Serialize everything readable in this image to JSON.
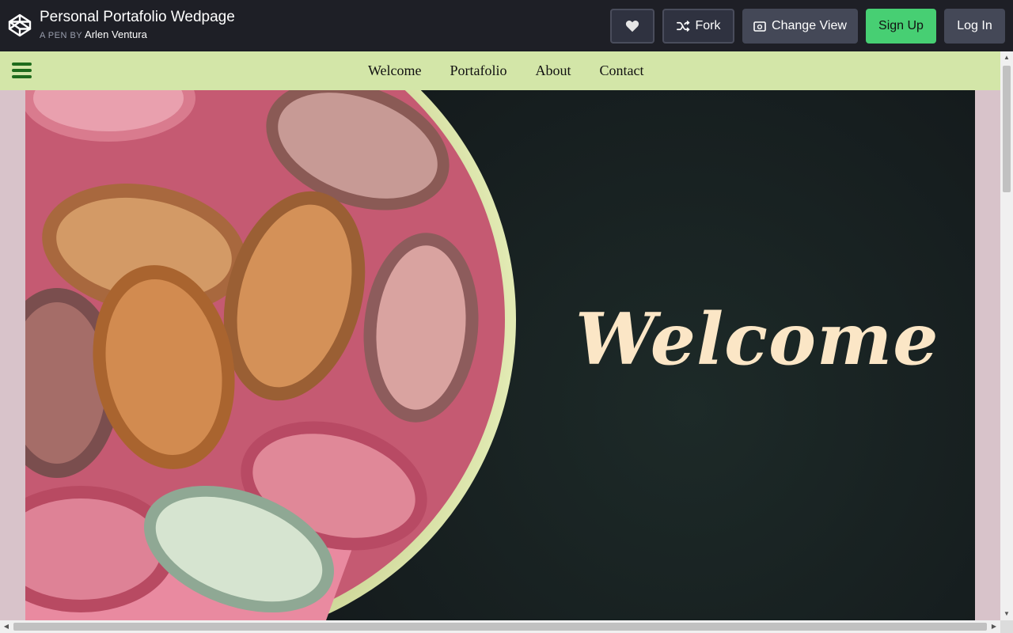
{
  "header": {
    "pen_title": "Personal Portafolio Wedpage",
    "byline_prefix": "A PEN BY",
    "author": "Arlen Ventura",
    "buttons": {
      "heart_icon": "heart-icon",
      "fork": "Fork",
      "change_view": "Change View",
      "sign_up": "Sign Up",
      "log_in": "Log In"
    }
  },
  "page": {
    "nav": {
      "items": [
        "Welcome",
        "Portafolio",
        "About",
        "Contact"
      ]
    },
    "hero": {
      "title": "Welcome"
    }
  },
  "colors": {
    "header_bg": "#1e1f26",
    "signup_green": "#47cf73",
    "nav_bg": "#d3e6a8",
    "page_bg": "#d8c3ca",
    "hero_title": "#fbe6c6",
    "hamburger": "#1f6b1c"
  }
}
